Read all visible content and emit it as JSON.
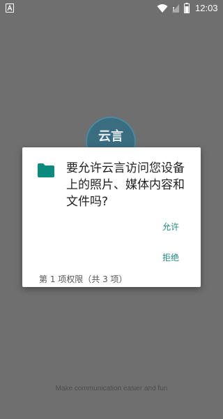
{
  "status_bar": {
    "time": "12:03",
    "icons": [
      "app-notification-icon",
      "wifi-icon",
      "signal-icon",
      "battery-icon"
    ],
    "text_color": "#ffffff"
  },
  "background": {
    "overlay_color": "#6f6f6f",
    "logo_text": "云言",
    "logo_color": "#3a6d80",
    "tagline": "Make communication easier and fun"
  },
  "dialog": {
    "icon": "folder-icon",
    "icon_color": "#0b8a7e",
    "message": "要允许云言访问您设备上的照片、媒体内容和文件吗?",
    "allow_label": "允许",
    "deny_label": "拒绝",
    "counter": "第 1 项权限（共 3 项）",
    "accent_color": "#1f8b80"
  }
}
